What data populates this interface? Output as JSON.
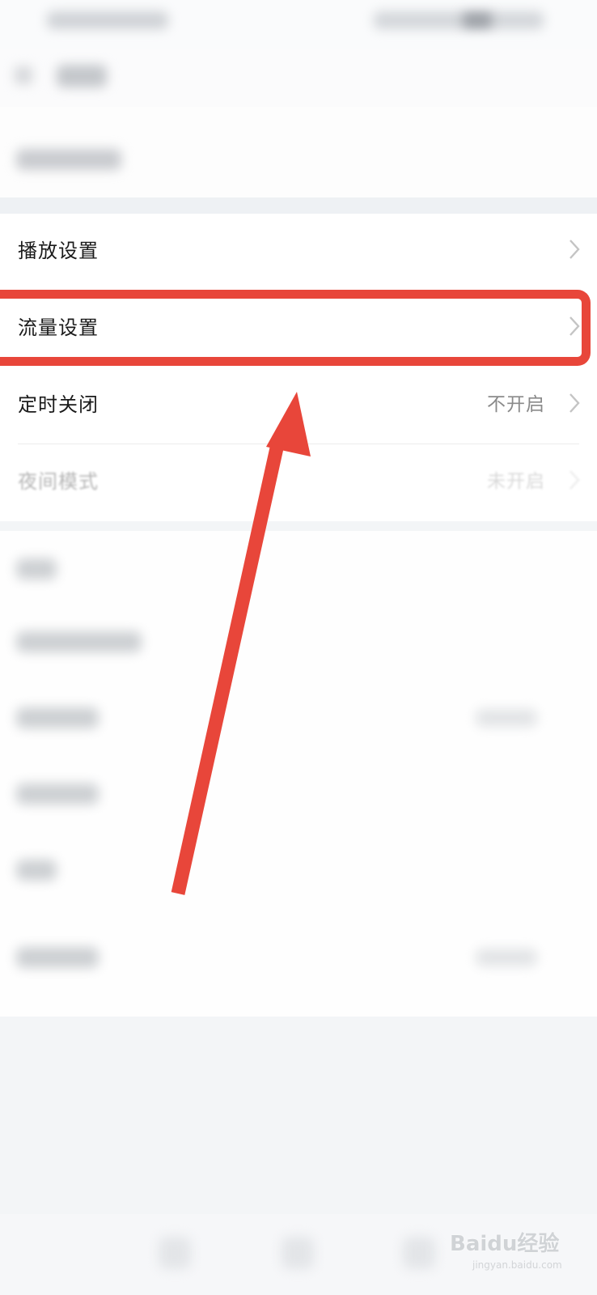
{
  "settings_rows": [
    {
      "label": "播放设置",
      "value": ""
    },
    {
      "label": "流量设置",
      "value": ""
    },
    {
      "label": "定时关闭",
      "value": "不开启"
    },
    {
      "label": "夜间模式",
      "value": "未开启"
    }
  ],
  "watermark": {
    "logo": "Baidu经验",
    "url": "jingyan.baidu.com"
  },
  "colors": {
    "annotation": "#e8463a",
    "background": "#f3f5f7",
    "row_text": "#1a1a1a",
    "value_text": "#8a8a8a"
  },
  "icons": {
    "row_chevron": "chevron-right-icon",
    "annotation_arrow": "arrow-up-icon"
  }
}
